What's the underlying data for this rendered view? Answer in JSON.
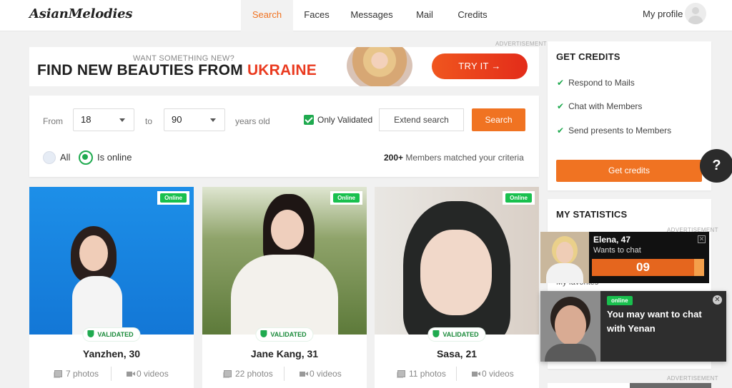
{
  "app": {
    "logo": "AsianMelodies"
  },
  "nav": {
    "items": [
      {
        "label": "Search",
        "active": true
      },
      {
        "label": "Faces",
        "active": false
      },
      {
        "label": "Messages",
        "active": false
      },
      {
        "label": "Mail",
        "active": false
      },
      {
        "label": "Credits",
        "active": false
      }
    ],
    "profile_label": "My profile"
  },
  "ad_label": "ADVERTISEMENT",
  "banner": {
    "subtitle": "WANT SOMETHING NEW?",
    "headline": "FIND NEW BEAUTIES FROM",
    "highlight": "UKRAINE",
    "button": "TRY IT →"
  },
  "search": {
    "from_label": "From",
    "from_value": "18",
    "to_label": "to",
    "to_value": "90",
    "age_suffix": "years old",
    "only_validated_label": "Only Validated",
    "only_validated_checked": true,
    "extend_button": "Extend search",
    "search_button": "Search",
    "radio_all": "All",
    "radio_online": "Is online",
    "radio_selected": "Is online",
    "match_count": "200+",
    "match_text": "Members matched your criteria"
  },
  "cards": [
    {
      "name": "Yanzhen, 30",
      "online": "Online",
      "validated": "VALIDATED",
      "photos": "7 photos",
      "videos": "0 videos"
    },
    {
      "name": "Jane Kang, 31",
      "online": "Online",
      "validated": "VALIDATED",
      "photos": "22 photos",
      "videos": "0 videos"
    },
    {
      "name": "Sasa, 21",
      "online": "Online",
      "validated": "VALIDATED",
      "photos": "11 photos",
      "videos": "0 videos"
    }
  ],
  "credits_box": {
    "title": "GET CREDITS",
    "benefits": [
      "Respond to Mails",
      "Chat with Members",
      "Send presents to Members"
    ],
    "button": "Get credits"
  },
  "help_button": "?",
  "stats_box": {
    "title": "MY STATISTICS",
    "favorites": "My favorites"
  },
  "chat_popup_1": {
    "name": "Elena, 47",
    "subtitle": "Wants to chat",
    "timer": "09"
  },
  "chat_popup_2": {
    "status": "online",
    "message": "You may want to chat with Yenan"
  },
  "colors": {
    "accent": "#f07322",
    "online": "#19c04e",
    "validated": "#1faa4f",
    "ad_red": "#ea3a1f"
  }
}
